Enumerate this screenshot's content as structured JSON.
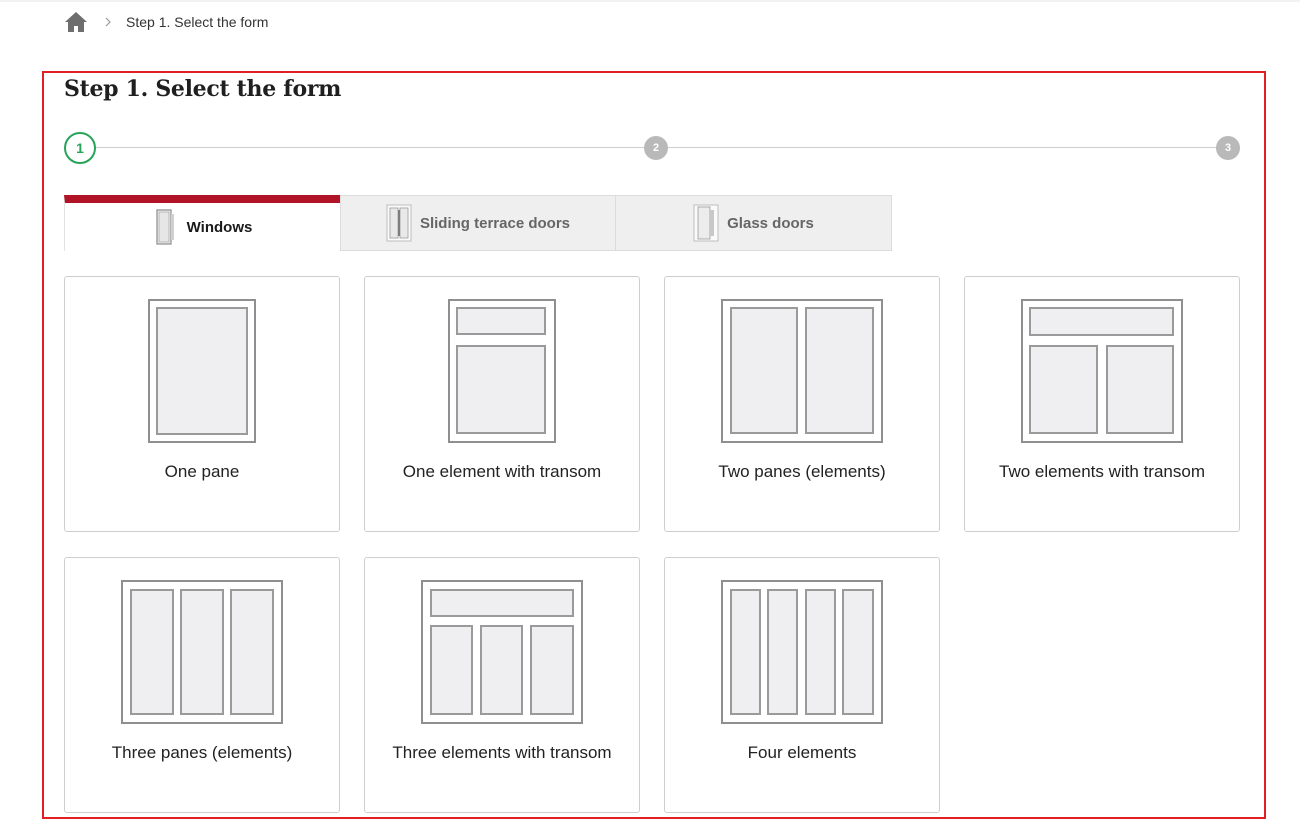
{
  "breadcrumb": {
    "home_icon": "home-icon",
    "separator_icon": "chevron-right-icon",
    "current": "Step 1. Select the form"
  },
  "page": {
    "title": "Step 1. Select the form",
    "accent_color": "#b01426",
    "frame_color": "#e41e26"
  },
  "stepper": {
    "steps": [
      {
        "label": "1",
        "state": "active",
        "color": "#27a35a"
      },
      {
        "label": "2",
        "state": "inactive",
        "color": "#b9b9b9"
      },
      {
        "label": "3",
        "state": "inactive",
        "color": "#b9b9b9"
      }
    ]
  },
  "tabs": [
    {
      "label": "Windows",
      "icon": "window-icon",
      "active": true
    },
    {
      "label": "Sliding terrace doors",
      "icon": "sliding-door-icon",
      "active": false
    },
    {
      "label": "Glass doors",
      "icon": "glass-door-icon",
      "active": false
    }
  ],
  "forms": [
    {
      "label": "One pane",
      "icon": "one-pane-icon"
    },
    {
      "label": "One element with transom",
      "icon": "one-element-transom-icon"
    },
    {
      "label": "Two panes (elements)",
      "icon": "two-panes-icon"
    },
    {
      "label": "Two elements with transom",
      "icon": "two-elements-transom-icon"
    },
    {
      "label": "Three panes (elements)",
      "icon": "three-panes-icon"
    },
    {
      "label": "Three elements with transom",
      "icon": "three-elements-transom-icon"
    },
    {
      "label": "Four elements",
      "icon": "four-elements-icon"
    }
  ]
}
